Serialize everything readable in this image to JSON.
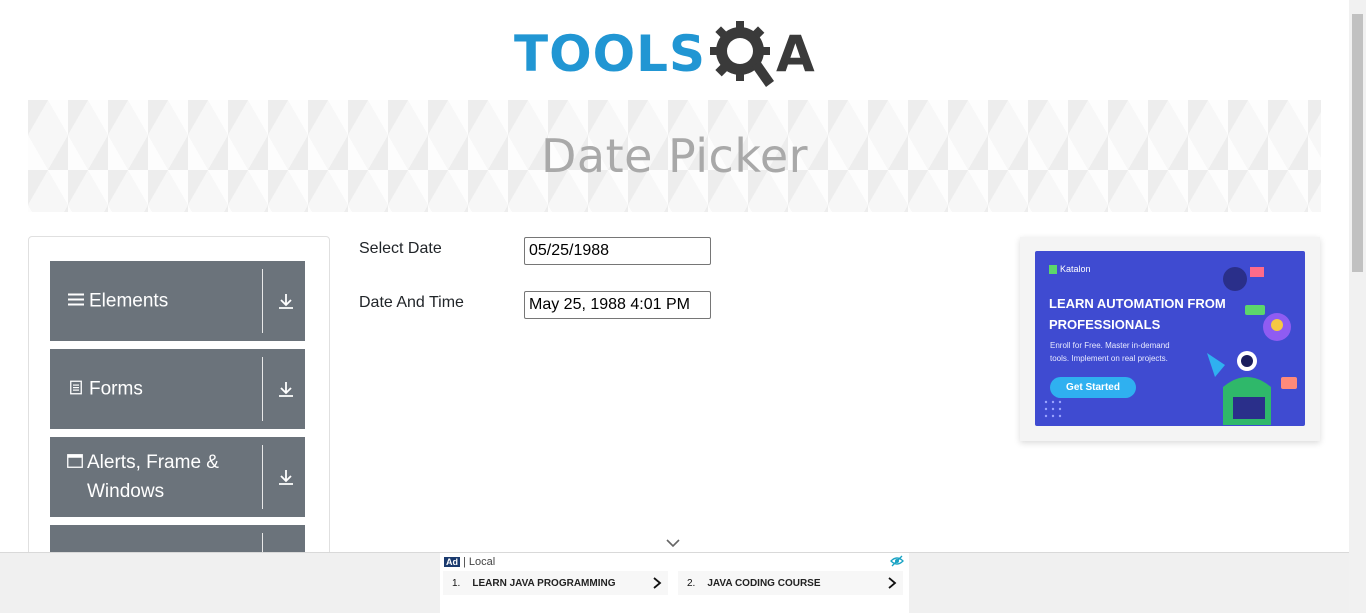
{
  "logo": {
    "text_tools": "TOOLS",
    "text_a": "A"
  },
  "banner": {
    "title": "Date Picker"
  },
  "sidebar": {
    "groups": [
      {
        "label": "Elements",
        "icon": "menu-icon"
      },
      {
        "label": "Forms",
        "icon": "document-icon"
      },
      {
        "label": "Alerts, Frame & Windows",
        "icon": "window-icon"
      },
      {
        "label": "",
        "icon": ""
      }
    ]
  },
  "form": {
    "select_date_label": "Select Date",
    "select_date_value": "05/25/1988",
    "date_time_label": "Date And Time",
    "date_time_value": "May 25, 1988 4:01 PM"
  },
  "side_ad": {
    "brand": "Katalon",
    "headline": "LEARN AUTOMATION FROM PROFESSIONALS",
    "subtext": "Enroll for Free. Master in-demand tools. Implement on real projects.",
    "button": "Get Started"
  },
  "bottom_ad": {
    "ad_label": "Ad",
    "tag": "| Local",
    "links": [
      {
        "num": "1.",
        "label": "LEARN JAVA PROGRAMMING"
      },
      {
        "num": "2.",
        "label": "JAVA CODING COURSE"
      }
    ]
  },
  "colors": {
    "brand_blue": "#2196d3",
    "sidebar_group": "#6b737b",
    "ad_blue": "#3f4bd1"
  }
}
